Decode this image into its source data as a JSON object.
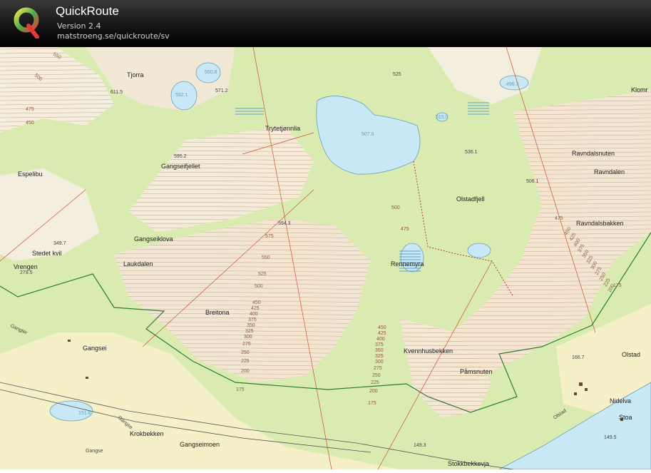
{
  "app": {
    "title": "QuickRoute",
    "version": "Version 2.4",
    "url": "matstroeng.se/quickroute/sv"
  },
  "icons": {
    "logo": "quickroute-q-logo"
  },
  "colors": {
    "header_bg": "#000000",
    "map_green": "#d9ebb0",
    "map_forest": "#c8e2a0",
    "open_land": "#f3eedd",
    "water": "#c8e8f5",
    "contour": "#c99a7a",
    "route": "#2e7d32"
  },
  "map": {
    "places": {
      "tjorra": "Tjorra",
      "trytetjonnlia": "Trytetjønnlia",
      "gangseifjellet": "Gangseifjellet",
      "espelibu": "Espelibu",
      "gangseiklova": "Gangseiklova",
      "stedet_kvil": "Stedet kvil",
      "vrengen": "Vrengen",
      "laukdalen": "Laukdalen",
      "breitona": "Breitona",
      "gangsei": "Gangsei",
      "krokbekken": "Krokbekken",
      "gangseimoen": "Gangseimoen",
      "olstadfjell": "Olstadfjell",
      "rennemyra": "Rennemyra",
      "kvennhusbekken": "Kvennhusbekken",
      "pramsnuten": "Påmsnuten",
      "ravndalsnuten": "Ravndalsnuten",
      "ravndalen": "Ravndalen",
      "ravndalsbakken": "Ravndalsbakken",
      "olstad": "Olstad",
      "nidelva": "Nidelva",
      "stoa": "Stoa",
      "stokkbekkevja": "Stokkbekkevja",
      "klomr": "Klomr",
      "gangter": "Gangter",
      "olstad_road": "Olstad",
      "gangse_river": "Gangse",
      "gangse_bottom": "Gangse"
    },
    "elevations": {
      "e550_tl": "550",
      "e500_tl": "500",
      "e475_tl": "475",
      "e450_tl": "450",
      "e611": "611.5",
      "e550_8": "550.8",
      "e552": "552.1",
      "e571": "571.2",
      "e525": "525",
      "e507": "507.6",
      "e496": "496.3",
      "e515": "515.0",
      "e536": "536.1",
      "e595": "595.2",
      "e594": "594.3",
      "e506": "506.1",
      "e349": "349.7",
      "e279": "279.5",
      "e166": "166.7",
      "e149_5": "149.5",
      "e149_3": "149.3",
      "e151": "151.6",
      "c575": "575",
      "c550": "550",
      "c525": "525",
      "c500": "500",
      "c500b": "500",
      "c475b": "475",
      "c475r": "475",
      "c175": "175",
      "c175b": "175",
      "c175c": "175"
    },
    "contour_stack_left": [
      "450",
      "425",
      "400",
      "375",
      "350",
      "325",
      "300",
      "275",
      "250",
      "225",
      "200"
    ],
    "contour_stack_mid": [
      "450",
      "425",
      "400",
      "375",
      "350",
      "325",
      "300",
      "275",
      "250",
      "225",
      "200"
    ],
    "contour_stack_right": [
      "450",
      "425",
      "400",
      "375",
      "350",
      "325",
      "300",
      "275",
      "250",
      "225",
      "200"
    ]
  }
}
